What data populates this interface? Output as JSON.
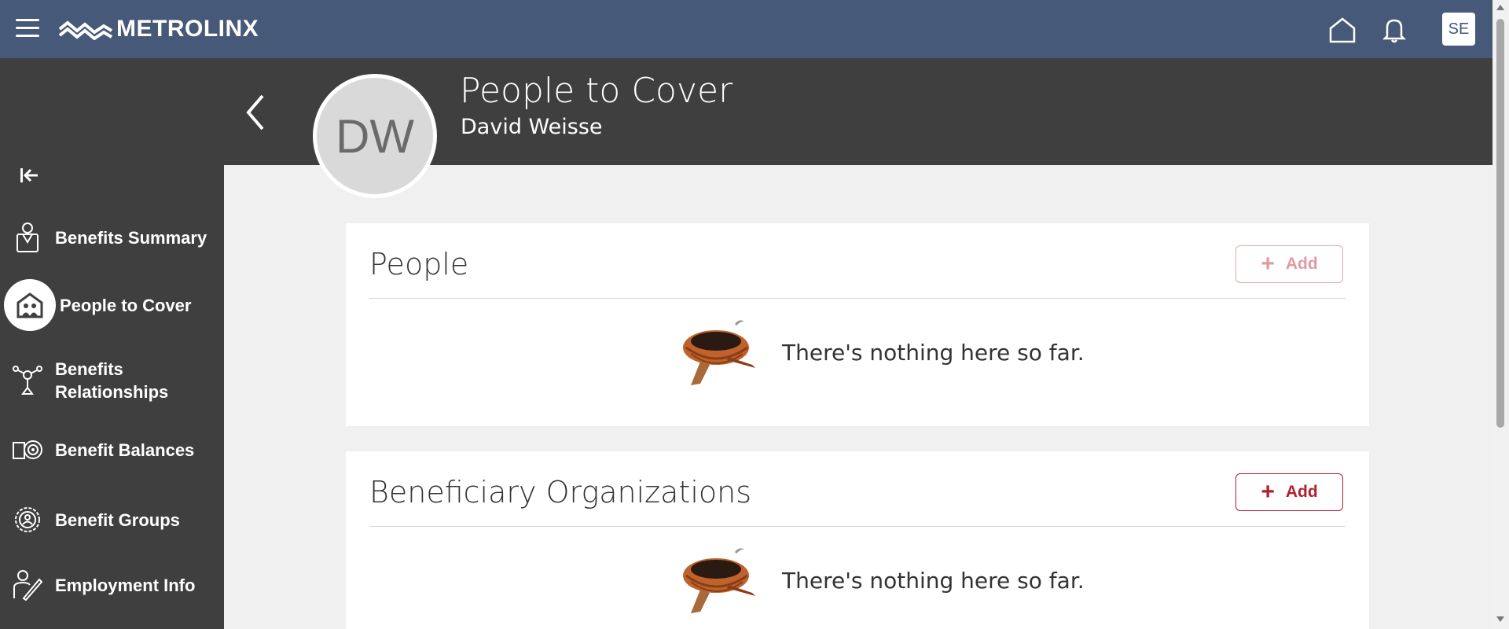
{
  "topbar": {
    "logo_text": "METROLINX",
    "user_initials": "SE",
    "colors": {
      "bar": "#465978"
    }
  },
  "sidebar": {
    "items": [
      {
        "label": "Benefits Summary",
        "icon": "person-badge-icon"
      },
      {
        "label": "People to Cover",
        "icon": "house-people-icon",
        "active": true
      },
      {
        "label": "Benefits Relationships",
        "icon": "network-icon"
      },
      {
        "label": "Benefit Balances",
        "icon": "balance-target-icon"
      },
      {
        "label": "Benefit Groups",
        "icon": "group-gear-icon"
      },
      {
        "label": "Employment Info",
        "icon": "person-pen-icon"
      }
    ]
  },
  "header": {
    "initials": "DW",
    "title": "People to Cover",
    "subtitle": "David Weisse"
  },
  "sections": [
    {
      "title": "People",
      "add_label": "Add",
      "add_enabled": false,
      "empty_text": "There's nothing here so far."
    },
    {
      "title": "Beneficiary Organizations",
      "add_label": "Add",
      "add_enabled": true,
      "empty_text": "There's nothing here so far."
    }
  ],
  "colors": {
    "accent": "#b21f2d",
    "sidebar": "#3f3f3f",
    "page": "#f0f0f0"
  }
}
